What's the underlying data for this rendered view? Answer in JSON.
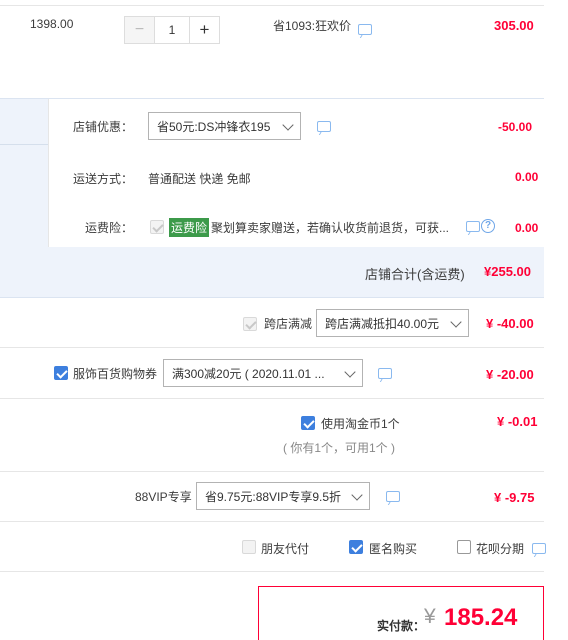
{
  "item": {
    "unit_price": "1398.00",
    "quantity": "1",
    "minus": "−",
    "plus": "+",
    "promo": "省1093:狂欢价",
    "subtotal": "305.00"
  },
  "shop": {
    "discount_label": "店铺优惠：",
    "discount_value": "省50元:DS冲锋衣195",
    "discount_amount": "-50.00",
    "shipping_label": "运送方式：",
    "shipping_value": "普通配送 快递 免邮",
    "shipping_amount": "0.00",
    "insurance_label": "运费险：",
    "insurance_badge": "运费险",
    "insurance_text": "聚划算卖家赠送，若确认收货前退货，可获...",
    "insurance_amount": "0.00",
    "total_label": "店铺合计(含运费)",
    "total_value": "¥255.00"
  },
  "cross_shop": {
    "label": "跨店满减",
    "select": "跨店满减抵扣40.00元",
    "amount": "¥ -40.00"
  },
  "coupon": {
    "label": "服饰百货购物券",
    "select": "满300减20元 ( 2020.11.01 ...",
    "amount": "¥ -20.00"
  },
  "taojinbi": {
    "label": "使用淘金币1个",
    "note": "( 你有1个，可用1个 )",
    "amount": "¥ -0.01"
  },
  "vip": {
    "label": "88VIP专享",
    "select": "省9.75元:88VIP专享9.5折",
    "amount": "¥ -9.75"
  },
  "options": {
    "friend_pay": "朋友代付",
    "anonymous": "匿名购买",
    "huabei": "花呗分期"
  },
  "payment": {
    "label": "实付款：",
    "currency": "¥",
    "amount": "185.24"
  },
  "colors": {
    "accent_red": "#ff0036",
    "checkbox_blue": "#3d7fde",
    "shop_bg": "#eef3fb",
    "badge_green": "#3c9a4a"
  }
}
